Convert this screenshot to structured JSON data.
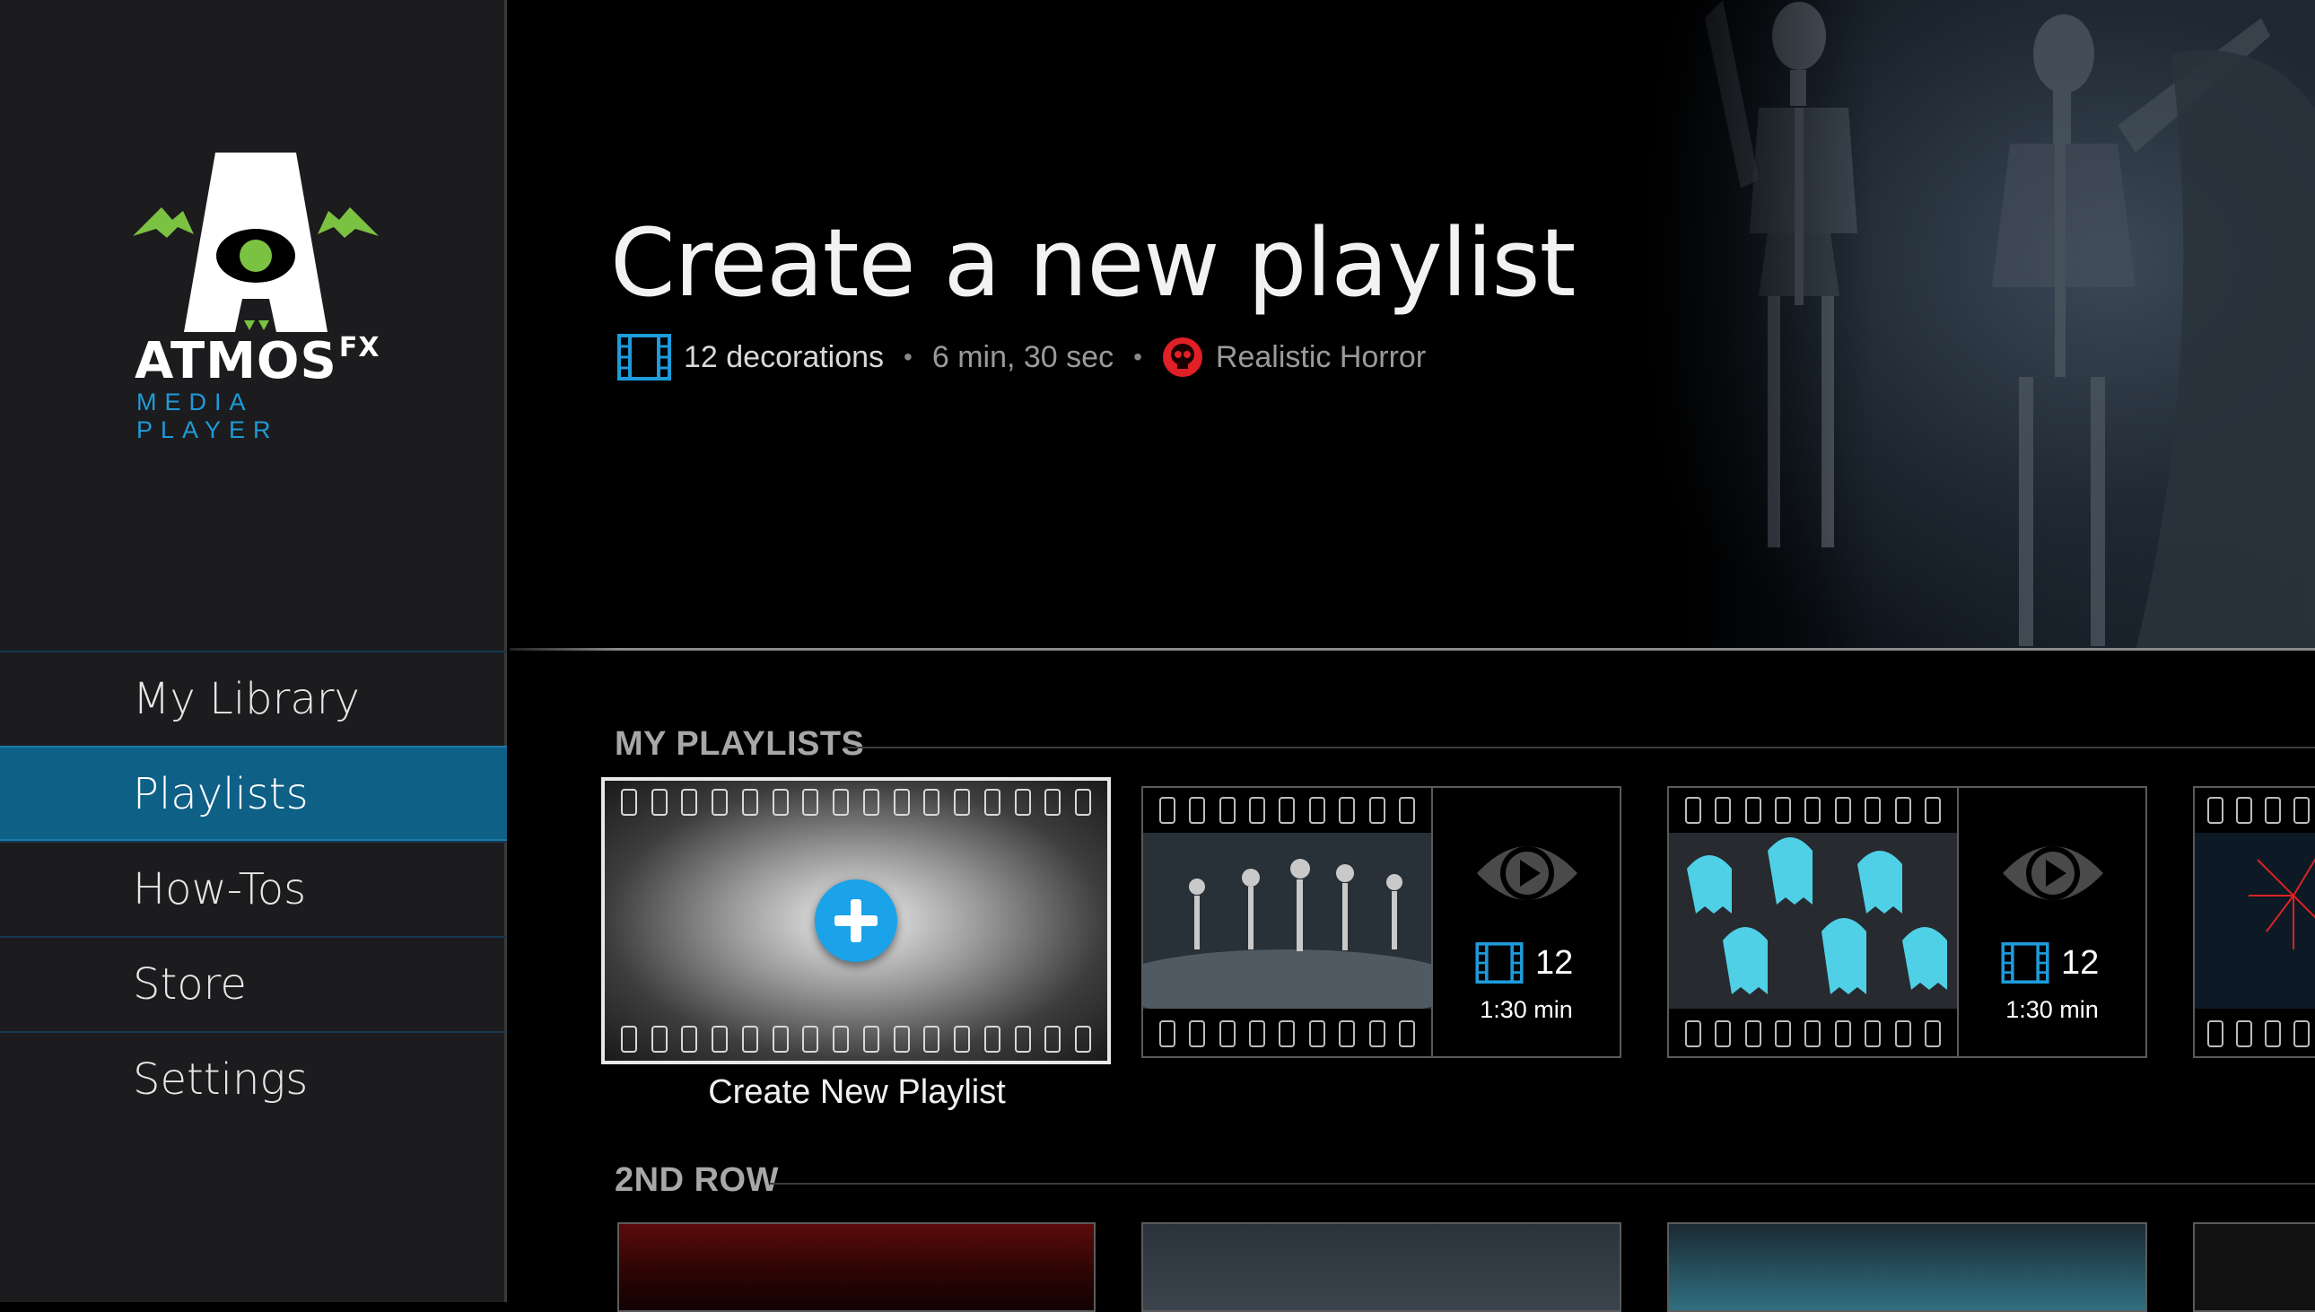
{
  "sidebar": {
    "logo": {
      "title": "ATMOS",
      "fx": "FX",
      "subtitle": "MEDIA PLAYER",
      "colors": {
        "accent_green": "#7cc242",
        "accent_blue": "#1e9bdb"
      }
    },
    "nav": [
      {
        "label": "My Library",
        "active": false
      },
      {
        "label": "Playlists",
        "active": true
      },
      {
        "label": "How-Tos",
        "active": false
      },
      {
        "label": "Store",
        "active": false
      },
      {
        "label": "Settings",
        "active": false
      }
    ]
  },
  "hero": {
    "title": "Create a new playlist",
    "decorations": "12 decorations",
    "duration": "6 min, 30 sec",
    "genre": "Realistic Horror",
    "icons": {
      "decorations": "film-strip-icon",
      "genre": "skull-icon"
    },
    "colors": {
      "film_icon": "#1e9bdb",
      "skull": "#e01f26"
    }
  },
  "sections": {
    "my_playlists": {
      "title": "MY PLAYLISTS",
      "create_card": {
        "caption": "Create New Playlist",
        "icon": "plus-icon"
      },
      "cards": [
        {
          "thumb": "dancing-skeletons",
          "count": "12",
          "duration": "1:30 min"
        },
        {
          "thumb": "blue-ghosts",
          "count": "12",
          "duration": "1:30 min"
        },
        {
          "thumb": "fireworks"
        }
      ]
    },
    "second_row": {
      "title": "2ND ROW"
    }
  }
}
